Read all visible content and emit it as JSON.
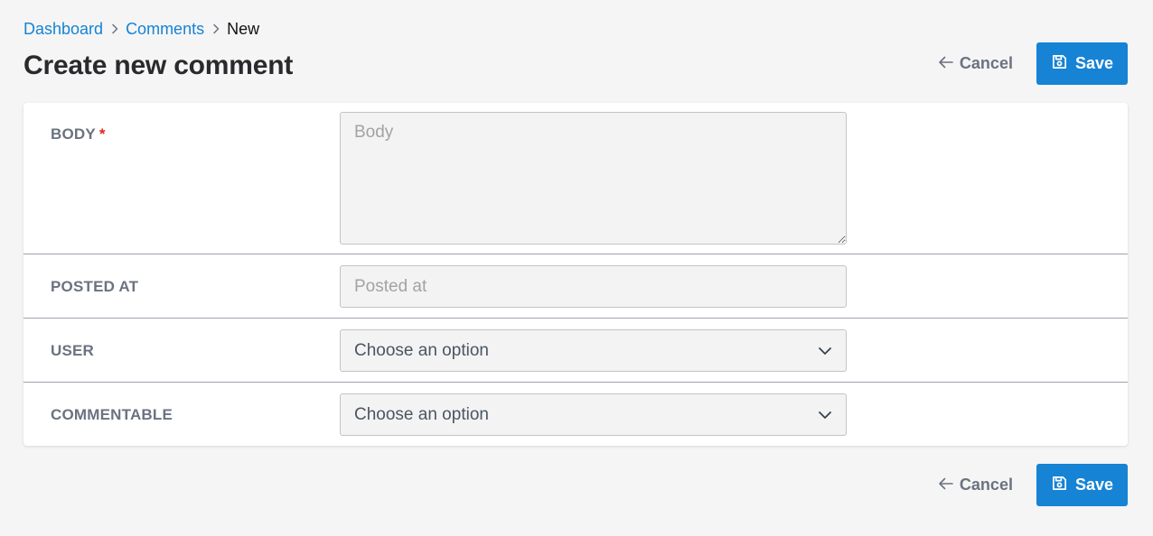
{
  "breadcrumb": {
    "items": [
      "Dashboard",
      "Comments"
    ],
    "current": "New"
  },
  "page": {
    "title": "Create new comment"
  },
  "actions": {
    "cancel_label": "Cancel",
    "save_label": "Save"
  },
  "form": {
    "body": {
      "label": "BODY",
      "required_mark": "*",
      "placeholder": "Body",
      "value": ""
    },
    "posted_at": {
      "label": "POSTED AT",
      "placeholder": "Posted at",
      "value": ""
    },
    "user": {
      "label": "USER",
      "selected": "Choose an option"
    },
    "commentable": {
      "label": "COMMENTABLE",
      "selected": "Choose an option"
    }
  },
  "colors": {
    "accent": "#1683d4",
    "background": "#f5f5f5",
    "required": "#dc2626",
    "label": "#6b7280"
  },
  "icons": [
    "chevron-right-icon",
    "arrow-left-icon",
    "save-icon",
    "chevron-down-icon",
    "resize-handle-icon"
  ]
}
